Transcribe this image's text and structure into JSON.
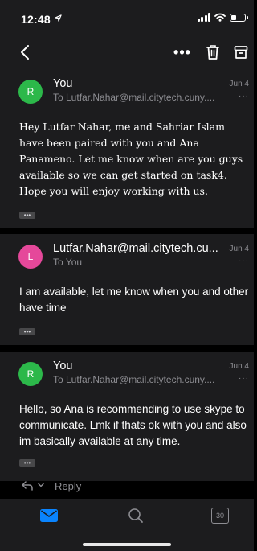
{
  "status_bar": {
    "time": "12:48",
    "battery_level": 0.4
  },
  "toolbar": {
    "more_label": "•••"
  },
  "colors": {
    "background": "#000000",
    "surface": "#1c1c1e",
    "secondary_text": "#8e8e93",
    "accent": "#0a84ff",
    "avatar_you": "#2cb84a",
    "avatar_lutfar": "#e5489a"
  },
  "messages": [
    {
      "avatar_letter": "R",
      "sender": "You",
      "recipient": "To Lutfar.Nahar@mail.citytech.cuny....",
      "date": "Jun 4",
      "more": "···",
      "body": "Hey Lutfar Nahar, me and Sahriar Islam have been paired with you and Ana Panameno. Let me know when are you guys available so we can get started on task4. Hope you will enjoy working with us.",
      "quote": "•••"
    },
    {
      "avatar_letter": "L",
      "sender": "Lutfar.Nahar@mail.citytech.cu...",
      "recipient": "To You",
      "date": "Jun 4",
      "more": "···",
      "body": "I am available, let me know when you and other have time",
      "quote": "•••"
    },
    {
      "avatar_letter": "R",
      "sender": "You",
      "recipient": "To Lutfar.Nahar@mail.citytech.cuny....",
      "date": "Jun 4",
      "more": "···",
      "body": "Hello, so Ana is recommending to use skype to communicate. Lmk if thats ok with you and also im basically available at any time.",
      "quote": "•••"
    }
  ],
  "reply_bar": {
    "label": "Reply"
  },
  "tab_bar": {
    "calendar_day": "30"
  }
}
